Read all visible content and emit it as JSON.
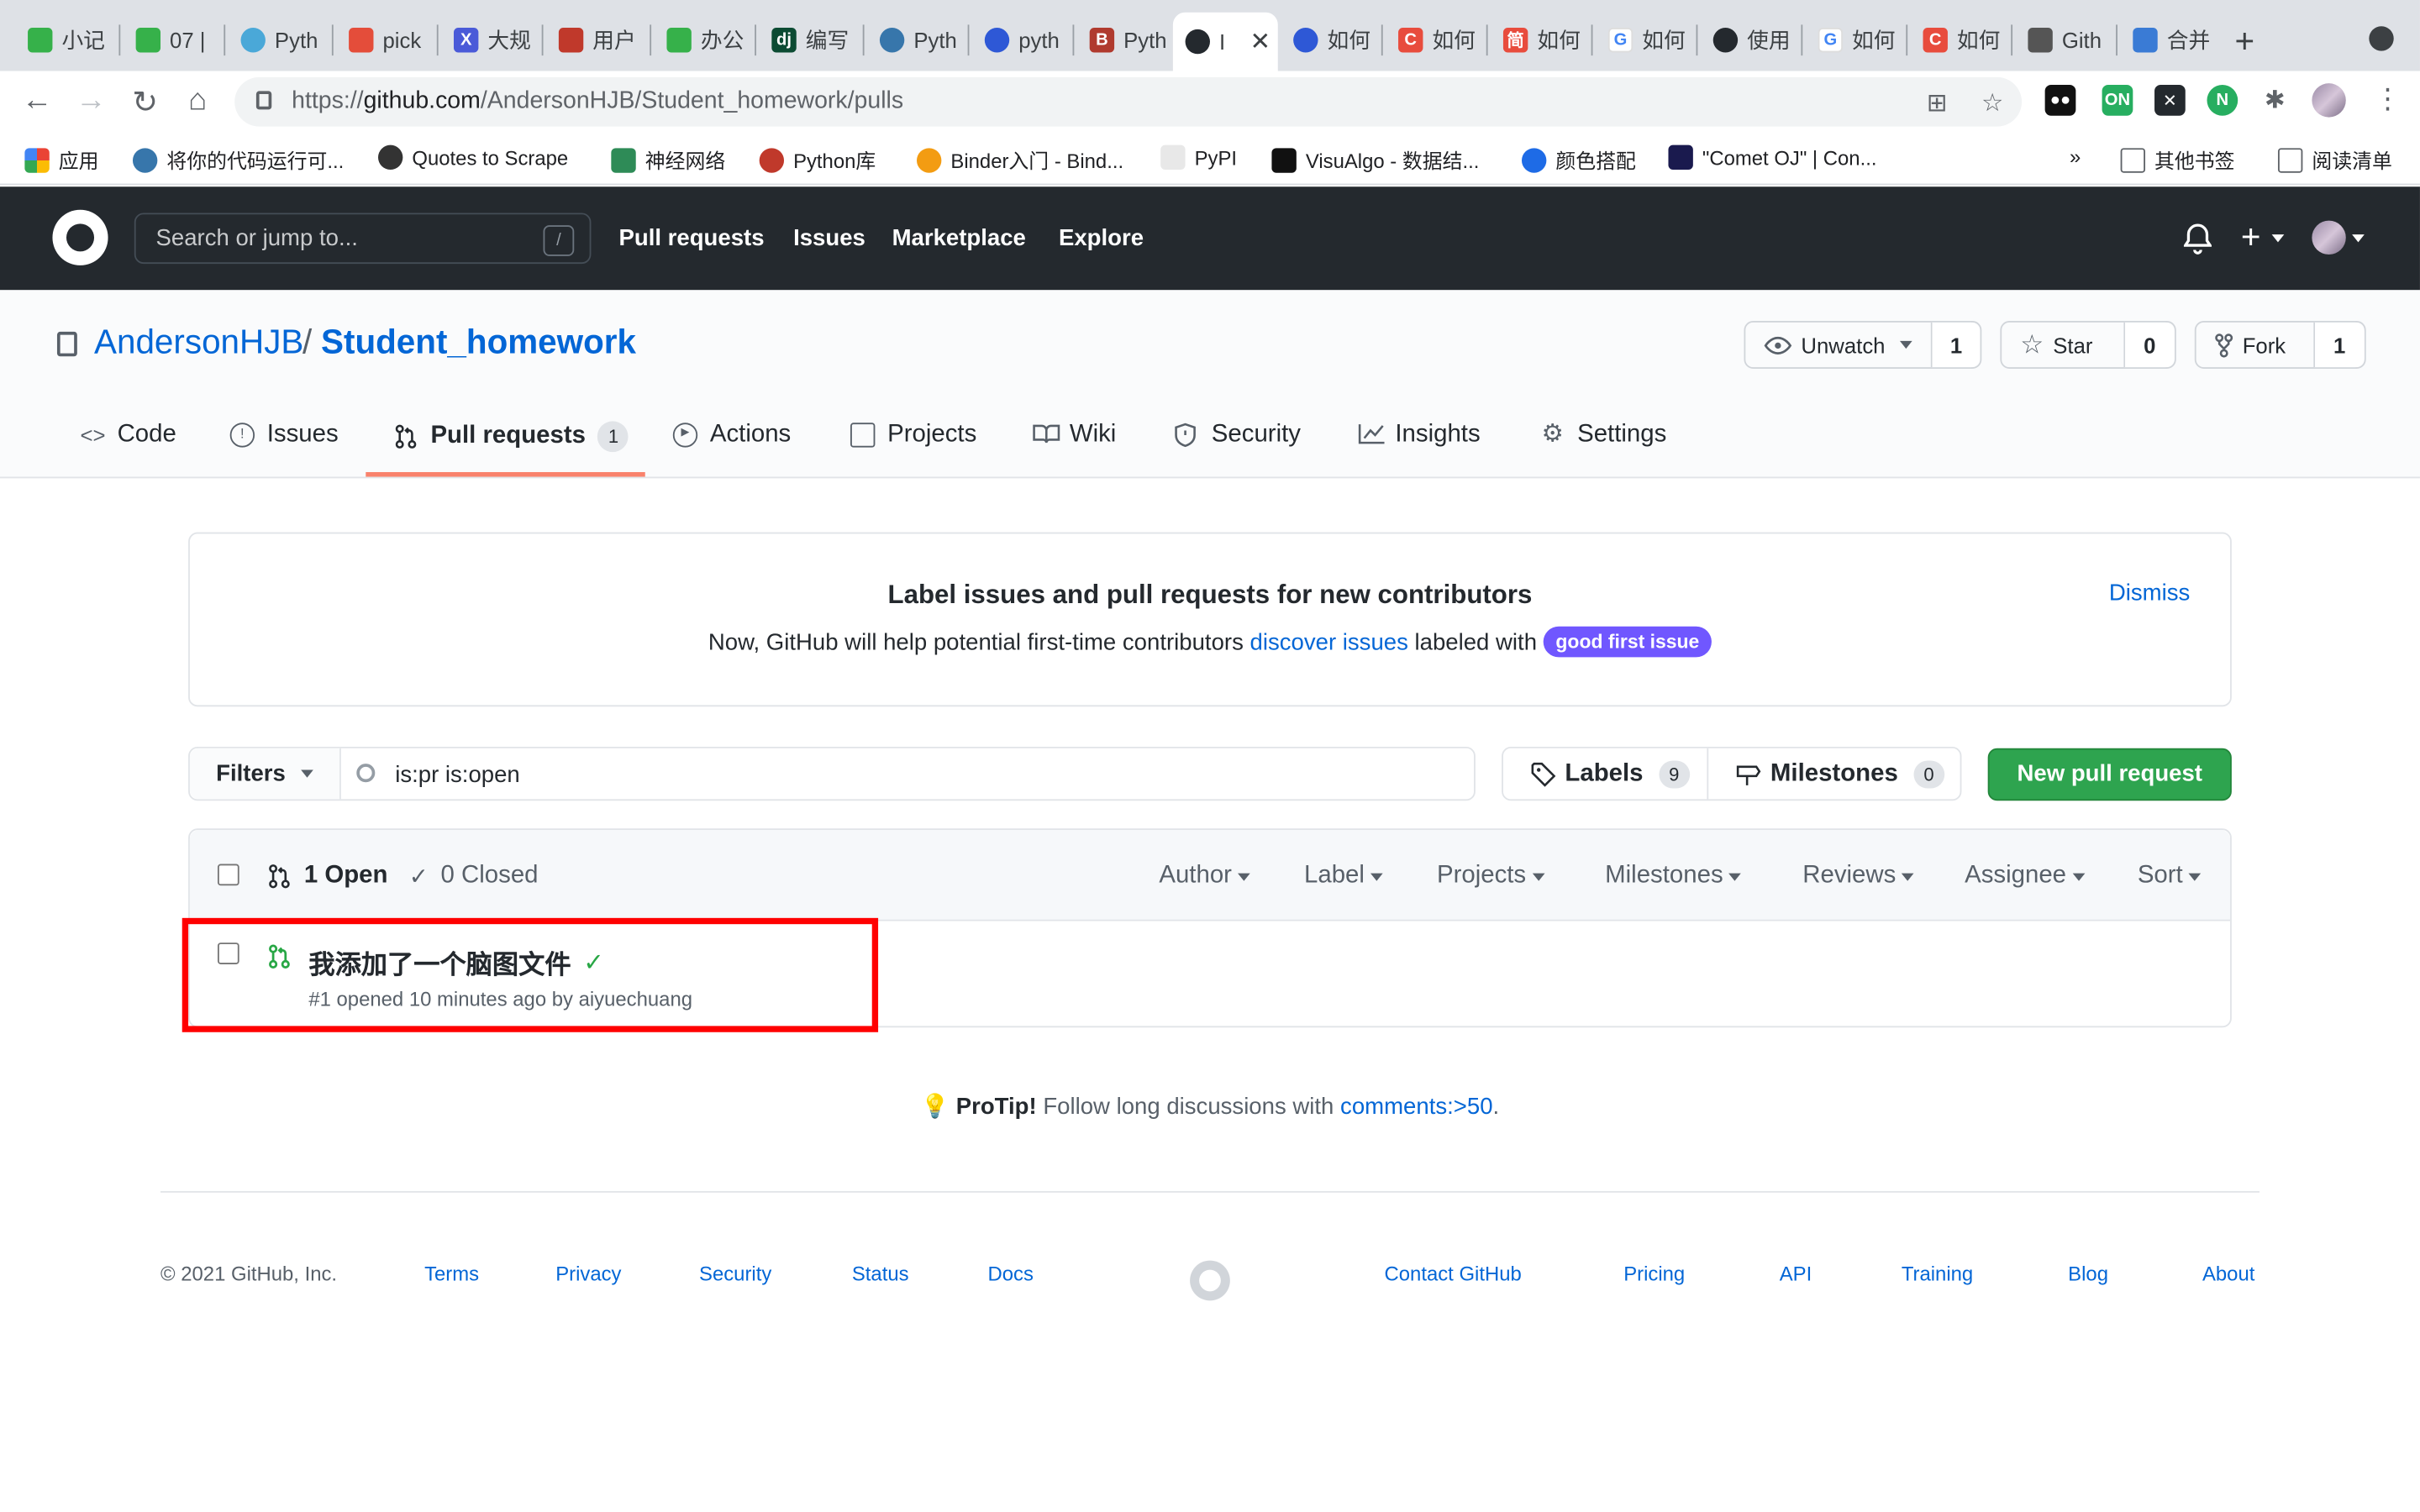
{
  "browser": {
    "tabs": [
      {
        "label": "小记",
        "color": "#36b14a"
      },
      {
        "label": "07 |",
        "color": "#36b14a"
      },
      {
        "label": "Pyth",
        "color": "#4aa8d8"
      },
      {
        "label": "pick",
        "color": "#e44d3a"
      },
      {
        "label": "大规",
        "color": "#4a5ad8"
      },
      {
        "label": "用户",
        "color": "#c0392b"
      },
      {
        "label": "办公",
        "color": "#36b14a"
      },
      {
        "label": "编写",
        "color": "#0c4b33"
      },
      {
        "label": "Pyth",
        "color": "#3776ab"
      },
      {
        "label": "pyth",
        "color": "#2e58d6"
      },
      {
        "label": "Pyth",
        "color": "#b03a2e"
      },
      {
        "label": "I",
        "color": "#24292e"
      },
      {
        "label": "如何",
        "color": "#2e58d6"
      },
      {
        "label": "如何",
        "color": "#e84c3d"
      },
      {
        "label": "如何",
        "color": "#e84c3d"
      },
      {
        "label": "如何",
        "color": "#4285f4"
      },
      {
        "label": "使用",
        "color": "#24292e"
      },
      {
        "label": "如何",
        "color": "#4285f4"
      },
      {
        "label": "如何",
        "color": "#e84c3d"
      },
      {
        "label": "Gith",
        "color": "#555555"
      },
      {
        "label": "合并",
        "color": "#3a7bd5"
      }
    ],
    "url_prefix": "https://",
    "url_host": "github.com",
    "url_path": "/AndersonHJB/Student_homework/pulls",
    "bookmarks": [
      {
        "label": "应用",
        "color": "#e84c3d"
      },
      {
        "label": "将你的代码运行可...",
        "color": "#3776ab"
      },
      {
        "label": "Quotes to Scrape",
        "color": "#333333"
      },
      {
        "label": "神经网络",
        "color": "#2e8b57"
      },
      {
        "label": "Python库",
        "color": "#c0392b"
      },
      {
        "label": "Binder入门 - Bind...",
        "color": "#f39c12"
      },
      {
        "label": "PyPI",
        "color": "#dddddd"
      },
      {
        "label": "VisuAlgo - 数据结...",
        "color": "#111111"
      },
      {
        "label": "颜色搭配",
        "color": "#1e6be6"
      },
      {
        "label": "\"Comet OJ\" | Con...",
        "color": "#1a1a4e"
      }
    ],
    "bookmarks_more": "»",
    "other_bookmarks": "其他书签",
    "reading_list": "阅读清单"
  },
  "header": {
    "search_placeholder": "Search or jump to...",
    "search_shortcut": "/",
    "nav": [
      "Pull requests",
      "Issues",
      "Marketplace",
      "Explore"
    ]
  },
  "repo": {
    "owner": "AndersonHJB",
    "separator": "/",
    "name": "Student_homework",
    "watch_label": "Unwatch",
    "watch_count": "1",
    "star_label": "Star",
    "star_count": "0",
    "fork_label": "Fork",
    "fork_count": "1",
    "tabs": [
      {
        "label": "Code"
      },
      {
        "label": "Issues"
      },
      {
        "label": "Pull requests",
        "count": "1"
      },
      {
        "label": "Actions"
      },
      {
        "label": "Projects"
      },
      {
        "label": "Wiki"
      },
      {
        "label": "Security"
      },
      {
        "label": "Insights"
      },
      {
        "label": "Settings"
      }
    ]
  },
  "banner": {
    "title": "Label issues and pull requests for new contributors",
    "desc_before": "Now, GitHub will help potential first-time contributors ",
    "desc_link": "discover issues",
    "desc_after": " labeled with ",
    "label": "good first issue",
    "dismiss": "Dismiss"
  },
  "filters": {
    "button": "Filters",
    "query": "is:pr is:open",
    "labels_label": "Labels",
    "labels_count": "9",
    "milestones_label": "Milestones",
    "milestones_count": "0",
    "new_pr": "New pull request"
  },
  "list": {
    "open_label": "1 Open",
    "closed_label": "0 Closed",
    "header_filters": [
      "Author",
      "Label",
      "Projects",
      "Milestones",
      "Reviews",
      "Assignee",
      "Sort"
    ],
    "items": [
      {
        "title": "我添加了一个脑图文件",
        "meta": "#1 opened 10 minutes ago by aiyuechuang"
      }
    ]
  },
  "protip": {
    "strong": "ProTip!",
    "text": " Follow long discussions with ",
    "link": "comments:>50",
    "end": "."
  },
  "footer": {
    "copyright": "© 2021 GitHub, Inc.",
    "left_links": [
      "Terms",
      "Privacy",
      "Security",
      "Status",
      "Docs"
    ],
    "right_links": [
      "Contact GitHub",
      "Pricing",
      "API",
      "Training",
      "Blog",
      "About"
    ]
  }
}
